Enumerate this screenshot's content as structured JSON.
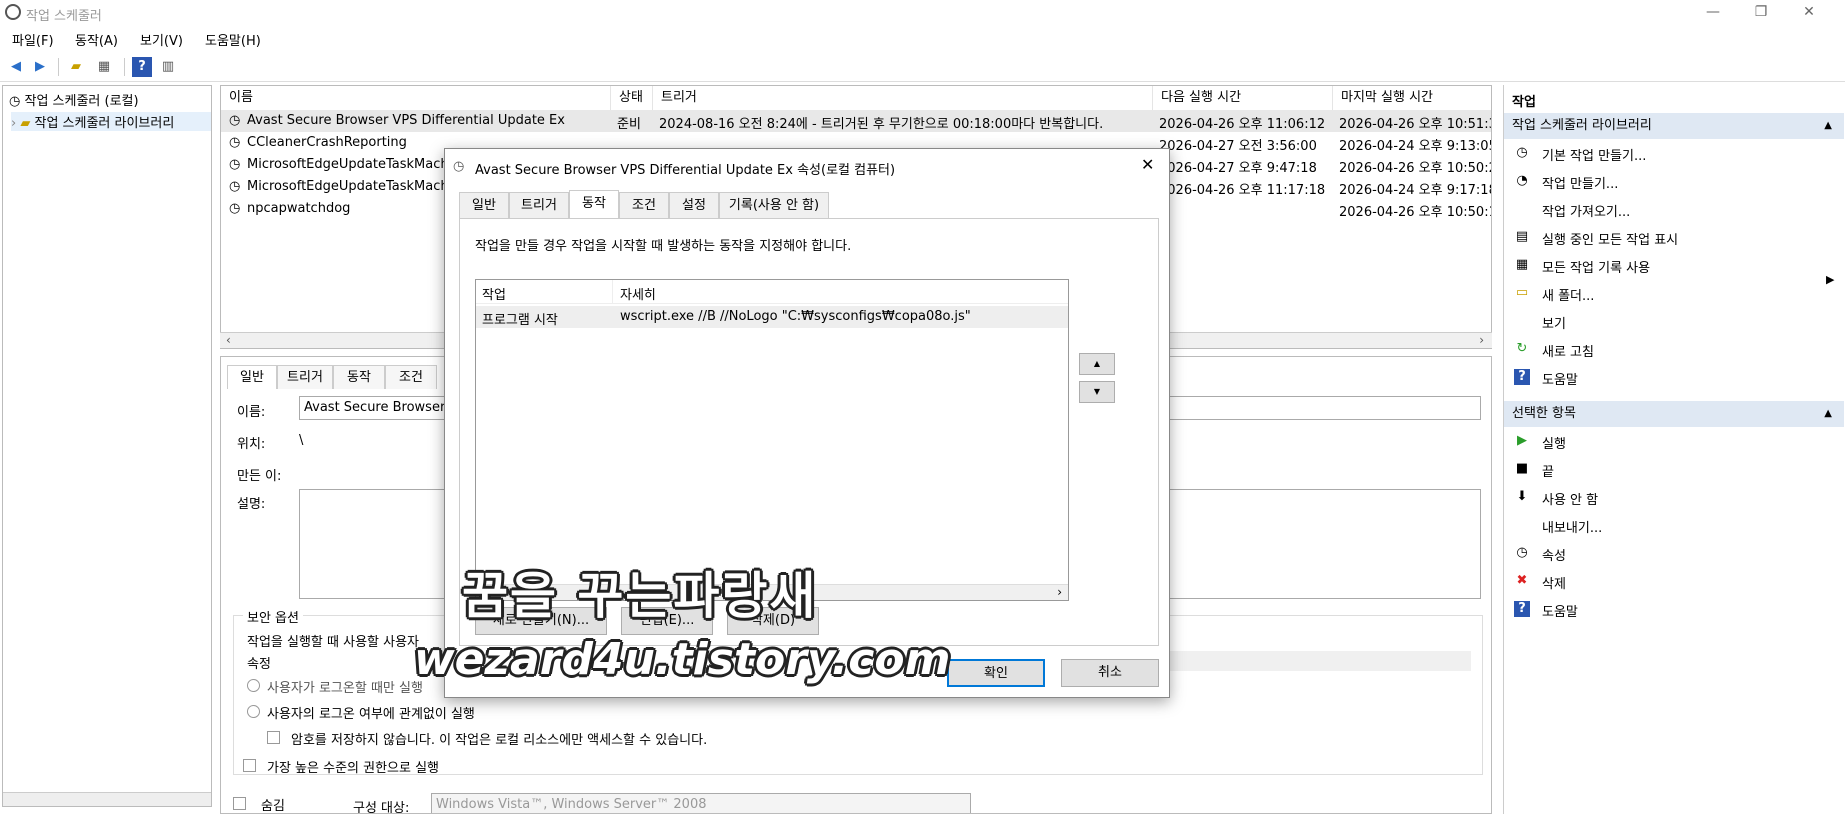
{
  "window": {
    "title": "작업 스케줄러",
    "minimize": "—",
    "restore": "❐",
    "close": "✕"
  },
  "menu": [
    "파일(F)",
    "동작(A)",
    "보기(V)",
    "도움말(H)"
  ],
  "tree": {
    "root": "작업 스케줄러 (로컬)",
    "child": "작업 스케줄러 라이브러리"
  },
  "tasklist": {
    "columns": [
      "이름",
      "상태",
      "트리거",
      "다음 실행 시간",
      "마지막 실행 시간"
    ],
    "rows": [
      {
        "name": "Avast Secure Browser VPS Differential Update Ex",
        "status": "준비",
        "trigger": "2024-08-16 오전 8:24에 - 트리거된 후 무기한으로 00:18:00마다 반복합니다.",
        "next": "2026-04-26 오후 11:06:12",
        "last": "2026-04-26 오후 10:51:3"
      },
      {
        "name": "CCleanerCrashReporting",
        "status": "",
        "trigger": "",
        "next": "2026-04-27 오전 3:56:00",
        "last": "2026-04-24 오후 9:13:05"
      },
      {
        "name": "MicrosoftEdgeUpdateTaskMachi",
        "status": "",
        "trigger": "",
        "next": "2026-04-27 오후 9:47:18",
        "last": "2026-04-26 오후 10:50:2"
      },
      {
        "name": "MicrosoftEdgeUpdateTaskMachi",
        "status": "",
        "trigger": "",
        "next": "2026-04-26 오후 11:17:18",
        "last": "2026-04-24 오후 9:17:18"
      },
      {
        "name": "npcapwatchdog",
        "status": "",
        "trigger": "",
        "next": "",
        "last": "2026-04-26 오후 10:50:1"
      }
    ]
  },
  "detail": {
    "tabs": [
      "일반",
      "트리거",
      "동작",
      "조건"
    ],
    "name_label": "이름:",
    "name_value": "Avast Secure Browser V",
    "location_label": "위치:",
    "location_value": "\\",
    "author_label": "만든 이:",
    "desc_label": "설명:",
    "security_title": "보안 옵션",
    "security_text": "작업을 실행할 때 사용할 사용자",
    "account": "속정",
    "radio1": "사용자가 로그온할 때만 실행",
    "radio2": "사용자의 로그온 여부에 관계없이 실행",
    "check_nosave": "암호를 저장하지 않습니다. 이 작업은 로컬 리소스에만 액세스할 수 있습니다.",
    "check_highest": "가장 높은 수준의 권한으로 실행",
    "hidden_label": "숨김",
    "config_label": "구성 대상:",
    "config_value": "Windows Vista™, Windows Server™ 2008"
  },
  "actions": {
    "header": "작업",
    "section1": "작업 스케줄러 라이브러리",
    "items1": [
      {
        "icon": "basic-task-icon",
        "glyph": "◷",
        "label": "기본 작업 만들기..."
      },
      {
        "icon": "create-task-icon",
        "glyph": "◔",
        "label": "작업 만들기..."
      },
      {
        "icon": "",
        "glyph": "",
        "label": "작업 가져오기..."
      },
      {
        "icon": "running-tasks-icon",
        "glyph": "▤",
        "label": "실행 중인 모든 작업 표시"
      },
      {
        "icon": "history-icon",
        "glyph": "▦",
        "label": "모든 작업 기록 사용"
      },
      {
        "icon": "new-folder-icon",
        "glyph": "▭",
        "label": "새 폴더..."
      },
      {
        "icon": "",
        "glyph": "",
        "label": "보기"
      },
      {
        "icon": "refresh-icon",
        "glyph": "↻",
        "label": "새로 고침"
      },
      {
        "icon": "help-icon",
        "glyph": "?",
        "label": "도움말"
      }
    ],
    "section2": "선택한 항목",
    "items2": [
      {
        "icon": "run-icon",
        "glyph": "▶",
        "label": "실행"
      },
      {
        "icon": "end-icon",
        "glyph": "■",
        "label": "끝"
      },
      {
        "icon": "disable-icon",
        "glyph": "⬇",
        "label": "사용 안 함"
      },
      {
        "icon": "",
        "glyph": "",
        "label": "내보내기..."
      },
      {
        "icon": "properties-icon",
        "glyph": "◷",
        "label": "속성"
      },
      {
        "icon": "delete-icon",
        "glyph": "✖",
        "label": "삭제"
      },
      {
        "icon": "help-icon",
        "glyph": "?",
        "label": "도움말"
      }
    ]
  },
  "dialog": {
    "title": "Avast Secure Browser VPS Differential Update Ex 속성(로컬 컴퓨터)",
    "tabs": [
      "일반",
      "트리거",
      "동작",
      "조건",
      "설정",
      "기록(사용 안 함)"
    ],
    "instruction": "작업을 만들 경우 작업을 시작할 때 발생하는 동작을 지정해야 합니다.",
    "grid_cols": [
      "작업",
      "자세히"
    ],
    "grid_row": {
      "action": "프로그램 시작",
      "detail": "wscript.exe //B //NoLogo \"C:₩sysconfigs₩copa08o.js\""
    },
    "new_btn": "새로 만들기(N)...",
    "edit_btn": "편집(E)...",
    "delete_btn": "삭제(D)",
    "ok": "확인",
    "cancel": "취소",
    "up": "▲",
    "down": "▼"
  },
  "watermark": {
    "line1": "꿈을 꾸는파랑새",
    "line2": "wezard4u.tistory.com"
  },
  "colors": {
    "section_bg": "#dfe8f3",
    "accent": "#0078d7"
  }
}
